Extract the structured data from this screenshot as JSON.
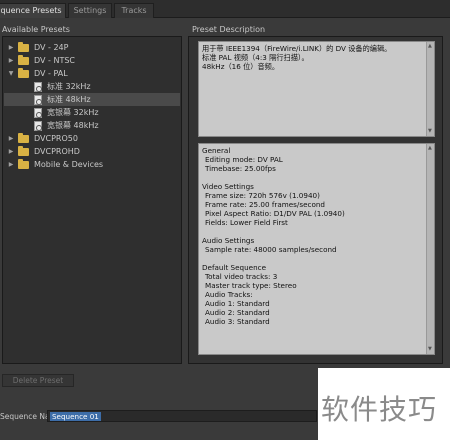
{
  "tabs": [
    {
      "label": "Sequence Presets",
      "active": true
    },
    {
      "label": "Settings",
      "active": false
    },
    {
      "label": "Tracks",
      "active": false
    }
  ],
  "left_panel": {
    "title": "Available Presets",
    "items": [
      {
        "label": "DV - 24P",
        "type": "folder",
        "expanded": false
      },
      {
        "label": "DV - NTSC",
        "type": "folder",
        "expanded": false
      },
      {
        "label": "DV - PAL",
        "type": "folder",
        "expanded": true
      },
      {
        "label": "标准 32kHz",
        "type": "preset",
        "selected": false
      },
      {
        "label": "标准 48kHz",
        "type": "preset",
        "selected": true
      },
      {
        "label": "宽银幕 32kHz",
        "type": "preset",
        "selected": false
      },
      {
        "label": "宽银幕 48kHz",
        "type": "preset",
        "selected": false
      },
      {
        "label": "DVCPRO50",
        "type": "folder",
        "expanded": false
      },
      {
        "label": "DVCPROHD",
        "type": "folder",
        "expanded": false
      },
      {
        "label": "Mobile & Devices",
        "type": "folder",
        "expanded": false
      }
    ]
  },
  "right_panel": {
    "title": "Preset Description",
    "description_lines": [
      "用于带 IEEE1394（FireWire/i.LINK）的 DV 设备的编辑。",
      "标准 PAL 视频（4:3 隔行扫描）。",
      "48kHz（16 位）音频。"
    ],
    "details": {
      "general_title": "General",
      "editing_mode": "Editing mode: DV PAL",
      "timebase": "Timebase: 25.00fps",
      "video_title": "Video Settings",
      "frame_size": "Frame size: 720h 576v (1.0940)",
      "frame_rate": "Frame rate: 25.00 frames/second",
      "pixel_aspect": "Pixel Aspect Ratio: D1/DV PAL (1.0940)",
      "fields": "Fields: Lower Field First",
      "audio_title": "Audio Settings",
      "sample_rate": "Sample rate: 48000 samples/second",
      "default_title": "Default Sequence",
      "total_video": "Total video tracks: 3",
      "master_track": "Master track type: Stereo",
      "audio_tracks": "Audio Tracks:",
      "audio1": "Audio 1: Standard",
      "audio2": "Audio 2: Standard",
      "audio3": "Audio 3: Standard"
    }
  },
  "footer": {
    "delete_label": "Delete Preset",
    "name_label": "Sequence Name:",
    "name_value": "Sequence 01"
  },
  "watermark": {
    "text": "软件技巧"
  },
  "colors": {
    "folder": "#d9b244",
    "selection": "#3d6da8",
    "panel": "#2f2f2f"
  }
}
